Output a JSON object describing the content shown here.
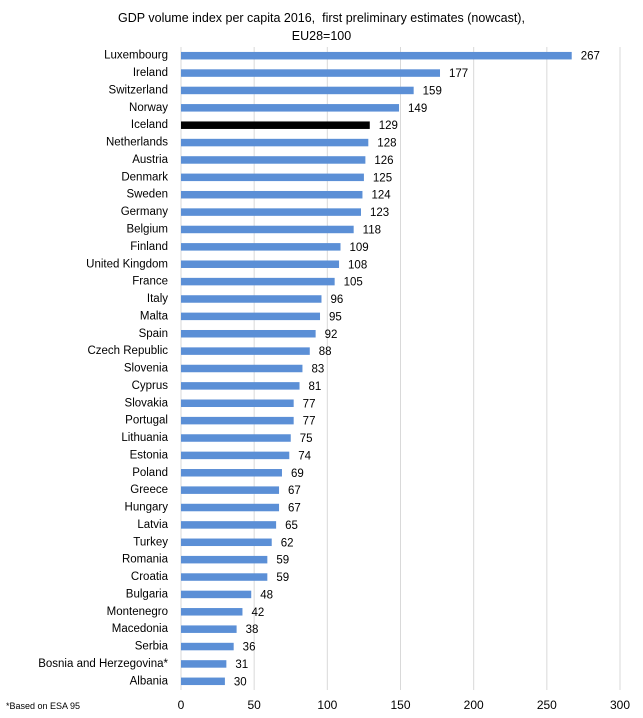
{
  "chart_data": {
    "type": "bar",
    "orientation": "horizontal",
    "title_lines": [
      "GDP volume index per capita 2016,  first preliminary estimates (nowcast),",
      "EU28=100"
    ],
    "xlabel": "",
    "ylabel": "",
    "xlim": [
      0,
      300
    ],
    "xticks": [
      0,
      50,
      100,
      150,
      200,
      250,
      300
    ],
    "grid": "vertical",
    "legend": "none",
    "bar_color": "#5b8fd6",
    "highlight_color": "#000000",
    "highlight_category": "Iceland",
    "categories": [
      "Luxembourg",
      "Ireland",
      "Switzerland",
      "Norway",
      "Iceland",
      "Netherlands",
      "Austria",
      "Denmark",
      "Sweden",
      "Germany",
      "Belgium",
      "Finland",
      "United Kingdom",
      "France",
      "Italy",
      "Malta",
      "Spain",
      "Czech Republic",
      "Slovenia",
      "Cyprus",
      "Slovakia",
      "Portugal",
      "Lithuania",
      "Estonia",
      "Poland",
      "Greece",
      "Hungary",
      "Latvia",
      "Turkey",
      "Romania",
      "Croatia",
      "Bulgaria",
      "Montenegro",
      "Macedonia",
      "Serbia",
      "Bosnia and Herzegovina*",
      "Albania"
    ],
    "values": [
      267,
      177,
      159,
      149,
      129,
      128,
      126,
      125,
      124,
      123,
      118,
      109,
      108,
      105,
      96,
      95,
      92,
      88,
      83,
      81,
      77,
      77,
      75,
      74,
      69,
      67,
      67,
      65,
      62,
      59,
      59,
      48,
      42,
      38,
      36,
      31,
      30
    ],
    "footnote": "*Based on ESA 95"
  }
}
